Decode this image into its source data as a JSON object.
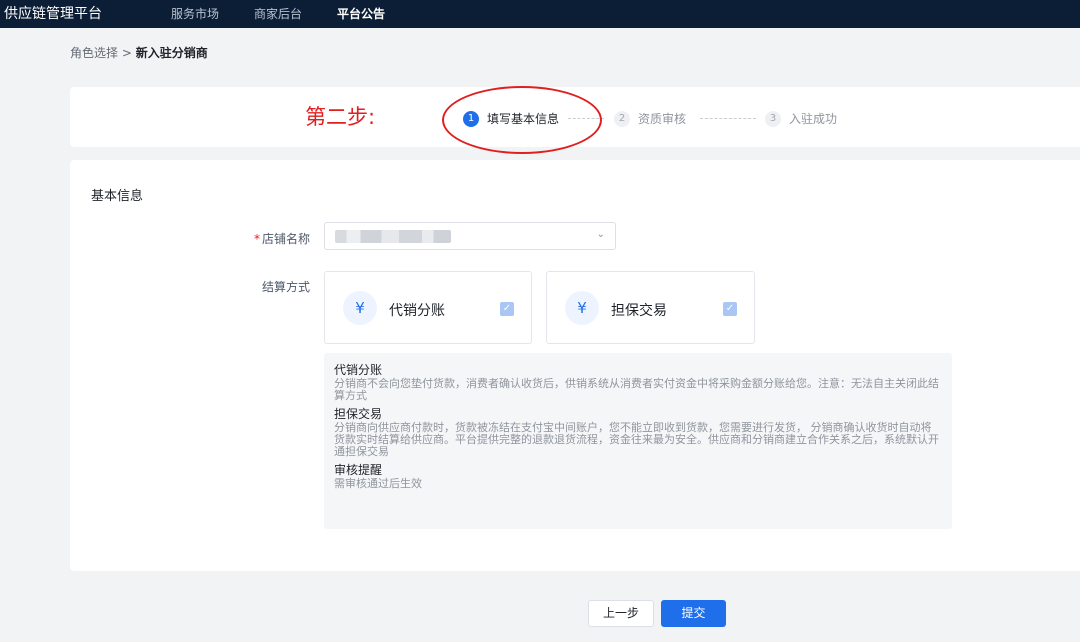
{
  "topbar": {
    "brand": "供应链管理平台",
    "nav": [
      "服务市场",
      "商家后台",
      "平台公告"
    ],
    "active_nav": "平台公告"
  },
  "breadcrumb": {
    "parent": "角色选择",
    "separator": ">",
    "current": "新入驻分销商"
  },
  "steps": {
    "annotation": "第二步:",
    "items": [
      {
        "num": "1",
        "label": "填写基本信息",
        "state": "active"
      },
      {
        "num": "2",
        "label": "资质审核",
        "state": "pending"
      },
      {
        "num": "3",
        "label": "入驻成功",
        "state": "pending"
      }
    ]
  },
  "form": {
    "section_title": "基本信息",
    "shop_name": {
      "required_mark": "*",
      "label": "店铺名称",
      "chevron": "⌄"
    },
    "settlement": {
      "label": "结算方式",
      "options": [
        {
          "icon": "receipt-yen-icon",
          "glyph": "¥",
          "label": "代销分账",
          "checked": true
        },
        {
          "icon": "shield-yen-icon",
          "glyph": "¥",
          "label": "担保交易",
          "checked": true
        }
      ],
      "check_glyph": "✓"
    }
  },
  "info": {
    "blocks": [
      {
        "title": "代销分账",
        "text": "分销商不会向您垫付货款，消费者确认收货后，供销系统从消费者实付资金中将采购金额分账给您。注意：无法自主关闭此结算方式"
      },
      {
        "title": "担保交易",
        "text": "分销商向供应商付款时，货款被冻结在支付宝中间账户，您不能立即收到货款，您需要进行发货， 分销商确认收货时自动将货款实时结算给供应商。平台提供完整的退款退货流程，资金往来最为安全。供应商和分销商建立合作关系之后，系统默认开通担保交易"
      },
      {
        "title": "审核提醒",
        "text": "需审核通过后生效"
      }
    ]
  },
  "footer": {
    "prev_label": "上一步",
    "submit_label": "提交"
  },
  "colors": {
    "topbar_bg": "#0b1e36",
    "primary": "#1f6feb",
    "annotation_red": "#e02020",
    "page_bg": "#f2f3f5"
  }
}
